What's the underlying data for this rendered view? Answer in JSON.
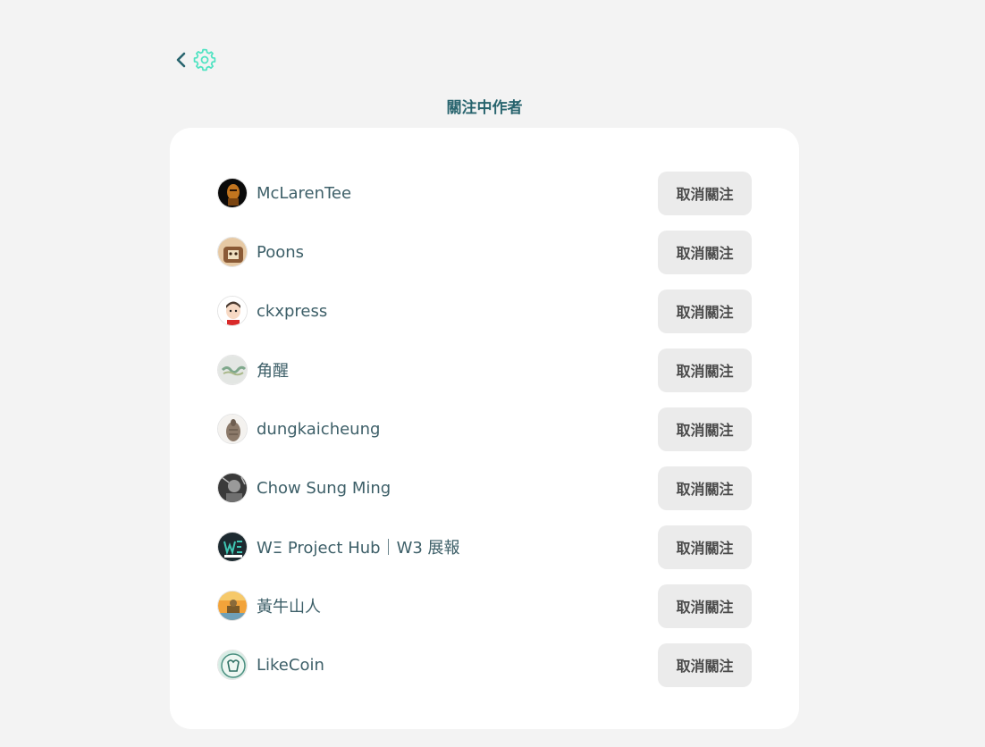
{
  "header": {
    "back_icon": "chevron-left-icon",
    "settings_icon": "gear-icon",
    "title": "關注中作者",
    "accent_color": "#50e3c2",
    "title_color": "#28646e"
  },
  "following": {
    "unfollow_label": "取消關注",
    "users": [
      {
        "name": "McLarenTee"
      },
      {
        "name": "Poons"
      },
      {
        "name": "ckxpress"
      },
      {
        "name": "角醒"
      },
      {
        "name": "dungkaicheung"
      },
      {
        "name": "Chow Sung Ming"
      },
      {
        "name": "WΞ Project Hub｜W3 展報"
      },
      {
        "name": "黃牛山人"
      },
      {
        "name": "LikeCoin"
      }
    ]
  }
}
